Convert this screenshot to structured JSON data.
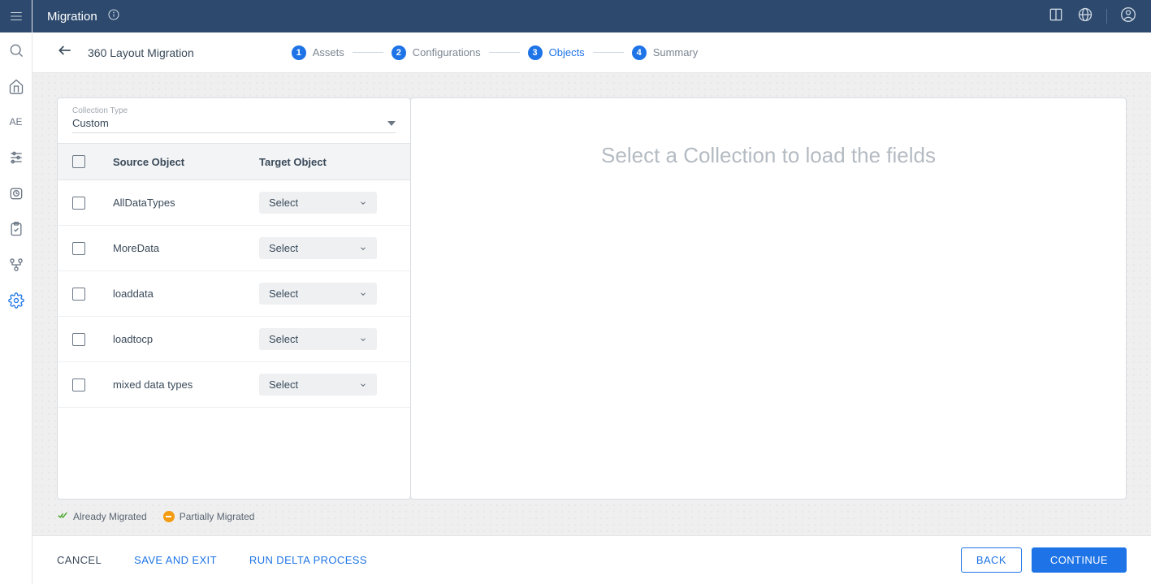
{
  "topbar": {
    "title": "Migration"
  },
  "subheader": {
    "breadcrumb": "360 Layout Migration"
  },
  "stepper": {
    "steps": [
      {
        "num": "1",
        "label": "Assets"
      },
      {
        "num": "2",
        "label": "Configurations"
      },
      {
        "num": "3",
        "label": "Objects"
      },
      {
        "num": "4",
        "label": "Summary"
      }
    ]
  },
  "collection": {
    "label": "Collection Type",
    "value": "Custom"
  },
  "table": {
    "headers": {
      "source": "Source Object",
      "target": "Target Object"
    },
    "rows": [
      {
        "source": "AllDataTypes",
        "target": "Select"
      },
      {
        "source": "MoreData",
        "target": "Select"
      },
      {
        "source": "loaddata",
        "target": "Select"
      },
      {
        "source": "loadtocp",
        "target": "Select"
      },
      {
        "source": "mixed data types",
        "target": "Select"
      }
    ]
  },
  "right_panel": {
    "placeholder": "Select a Collection to load the fields"
  },
  "legend": {
    "already": "Already Migrated",
    "partially": "Partially Migrated"
  },
  "footer": {
    "cancel": "CANCEL",
    "save_exit": "SAVE AND EXIT",
    "run_delta": "RUN DELTA PROCESS",
    "back": "BACK",
    "continue": "CONTINUE"
  },
  "rail": {
    "ae": "AE"
  }
}
